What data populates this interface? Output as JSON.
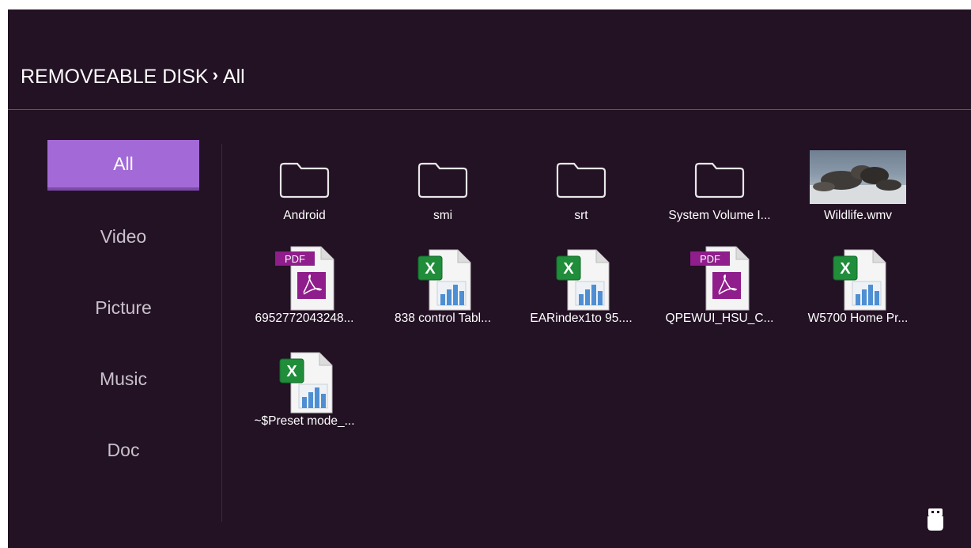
{
  "breadcrumb": {
    "root": "REMOVEABLE DISK",
    "separator": "›",
    "current": "All"
  },
  "sidebar": {
    "items": [
      {
        "label": "All",
        "active": true
      },
      {
        "label": "Video",
        "active": false
      },
      {
        "label": "Picture",
        "active": false
      },
      {
        "label": "Music",
        "active": false
      },
      {
        "label": "Doc",
        "active": false
      }
    ]
  },
  "files": [
    {
      "name": "Android",
      "type": "folder"
    },
    {
      "name": "smi",
      "type": "folder"
    },
    {
      "name": "srt",
      "type": "folder"
    },
    {
      "name": "System Volume I...",
      "type": "folder"
    },
    {
      "name": "Wildlife.wmv",
      "type": "video"
    },
    {
      "name": "6952772043248...",
      "type": "pdf"
    },
    {
      "name": "838 control Tabl...",
      "type": "excel"
    },
    {
      "name": "EARindex1to 95....",
      "type": "excel"
    },
    {
      "name": "QPEWUI_HSU_C...",
      "type": "pdf"
    },
    {
      "name": "W5700 Home Pr...",
      "type": "excel"
    },
    {
      "name": "~$Preset mode_...",
      "type": "excel"
    }
  ],
  "icons": {
    "pdf_badge": "PDF",
    "usb": "usb-drive-icon"
  },
  "colors": {
    "background": "#231124",
    "accent": "#a36ad7",
    "divider": "#6b4a8c",
    "pdf": "#8f1d8b",
    "excel": "#1f8d3a"
  }
}
